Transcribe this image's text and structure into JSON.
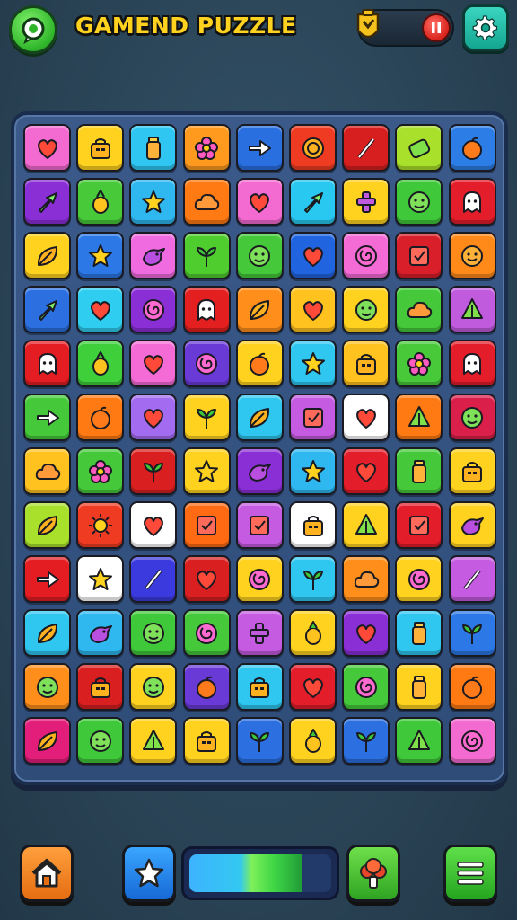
{
  "header": {
    "title": "GAMEND PUZZLE",
    "icons": {
      "logo": "chat-bubble-icon",
      "coin": "trophy-badge-icon",
      "red": "pause-icon",
      "settings": "gear-icon"
    }
  },
  "board": {
    "rows": [
      [
        [
          "#f36bd0",
          "heart"
        ],
        [
          "#ffd21f",
          "bag"
        ],
        [
          "#2fc6f2",
          "bottle"
        ],
        [
          "#ff9a1f",
          "flower"
        ],
        [
          "#2a6fe0",
          "arrow"
        ],
        [
          "#ef3b22",
          "coin"
        ],
        [
          "#d81f1f",
          "leaf-slash"
        ],
        [
          "#a8e02b",
          "can"
        ],
        [
          "#2d7de6",
          "fruit"
        ]
      ],
      [
        [
          "#8a2fd6",
          "arrow-up"
        ],
        [
          "#47c93a",
          "pineapple"
        ],
        [
          "#2fb7f0",
          "star"
        ],
        [
          "#ff7a12",
          "cloud"
        ],
        [
          "#f36bd0",
          "heart"
        ],
        [
          "#28c8f0",
          "arrow-up"
        ],
        [
          "#ffd21f",
          "cross"
        ],
        [
          "#3fc83a",
          "face"
        ],
        [
          "#e31d2a",
          "ghost"
        ]
      ],
      [
        [
          "#ffd21f",
          "leaf"
        ],
        [
          "#2b78e6",
          "star"
        ],
        [
          "#f06be0",
          "bird"
        ],
        [
          "#4fcd2f",
          "plant"
        ],
        [
          "#45c93a",
          "face"
        ],
        [
          "#2064df",
          "heart"
        ],
        [
          "#f46bd6",
          "swirl"
        ],
        [
          "#d91f2a",
          "card"
        ],
        [
          "#ff8a1a",
          "smile"
        ]
      ],
      [
        [
          "#2b6fe0",
          "arrow-up"
        ],
        [
          "#2fcdf0",
          "heart"
        ],
        [
          "#8a2fd6",
          "swirl"
        ],
        [
          "#e41f1f",
          "ghost"
        ],
        [
          "#ff8f1a",
          "leaf"
        ],
        [
          "#ffc21f",
          "heart"
        ],
        [
          "#ffd21f",
          "face"
        ],
        [
          "#45c93a",
          "cloud"
        ],
        [
          "#c15bde",
          "tree"
        ]
      ],
      [
        [
          "#e31d22",
          "ghost"
        ],
        [
          "#3ecf3a",
          "pineapple"
        ],
        [
          "#f46bd6",
          "heart"
        ],
        [
          "#6a3ad6",
          "swirl"
        ],
        [
          "#ffd21f",
          "fruit"
        ],
        [
          "#2fc6f0",
          "star"
        ],
        [
          "#ffc21f",
          "bag"
        ],
        [
          "#47c93a",
          "flower"
        ],
        [
          "#e31d2a",
          "ghost"
        ]
      ],
      [
        [
          "#45c93a",
          "arrow"
        ],
        [
          "#ff7a12",
          "fruit"
        ],
        [
          "#a26bf0",
          "heart"
        ],
        [
          "#ffd21f",
          "plant"
        ],
        [
          "#2fc6f0",
          "leaf"
        ],
        [
          "#c45be0",
          "card"
        ],
        [
          "#ffffff",
          "heart"
        ],
        [
          "#ff7a12",
          "tree"
        ],
        [
          "#d91f4a",
          "face"
        ]
      ],
      [
        [
          "#ffc21f",
          "cloud"
        ],
        [
          "#45c93a",
          "flower"
        ],
        [
          "#d91f1f",
          "plant"
        ],
        [
          "#ffd21f",
          "star"
        ],
        [
          "#8a2fd6",
          "bird"
        ],
        [
          "#2fb7f0",
          "star"
        ],
        [
          "#e31d2a",
          "heart"
        ],
        [
          "#45c93a",
          "bottle"
        ],
        [
          "#ffd21f",
          "bag"
        ]
      ],
      [
        [
          "#a8e02b",
          "leaf"
        ],
        [
          "#ef3b22",
          "sun"
        ],
        [
          "#ffffff",
          "heart"
        ],
        [
          "#ff6a12",
          "card"
        ],
        [
          "#c45be0",
          "card"
        ],
        [
          "#ffffff",
          "bag"
        ],
        [
          "#ffd21f",
          "tree"
        ],
        [
          "#e31d2a",
          "card"
        ],
        [
          "#ffd21f",
          "bird"
        ]
      ],
      [
        [
          "#e31d22",
          "arrow"
        ],
        [
          "#ffffff",
          "star"
        ],
        [
          "#3b3adf",
          "leaf-slash"
        ],
        [
          "#d91f1f",
          "heart"
        ],
        [
          "#ffd21f",
          "swirl"
        ],
        [
          "#2fc6f0",
          "plant"
        ],
        [
          "#ff8f1a",
          "cloud"
        ],
        [
          "#ffd21f",
          "swirl"
        ],
        [
          "#c45be0",
          "leaf-slash"
        ]
      ],
      [
        [
          "#2fc6f0",
          "leaf"
        ],
        [
          "#2fb7f0",
          "bird"
        ],
        [
          "#3fc83a",
          "face"
        ],
        [
          "#45c93a",
          "swirl"
        ],
        [
          "#c45be0",
          "cross"
        ],
        [
          "#ffd21f",
          "pineapple"
        ],
        [
          "#8a2fd6",
          "heart"
        ],
        [
          "#2fc6f0",
          "bottle"
        ],
        [
          "#2b78e6",
          "plant"
        ]
      ],
      [
        [
          "#ff8f1a",
          "face"
        ],
        [
          "#d91f1f",
          "bag"
        ],
        [
          "#ffd21f",
          "face"
        ],
        [
          "#6a3ad6",
          "fruit"
        ],
        [
          "#2fc6f0",
          "bag"
        ],
        [
          "#e31d2a",
          "heart"
        ],
        [
          "#45c93a",
          "swirl"
        ],
        [
          "#ffd21f",
          "bottle"
        ],
        [
          "#ff7a12",
          "fruit"
        ]
      ],
      [
        [
          "#e31d7a",
          "leaf"
        ],
        [
          "#3fc83a",
          "face"
        ],
        [
          "#ffd21f",
          "tree"
        ],
        [
          "#ffd21f",
          "bag"
        ],
        [
          "#2b6fe0",
          "plant"
        ],
        [
          "#ffd21f",
          "pineapple"
        ],
        [
          "#2b6fe0",
          "plant"
        ],
        [
          "#3fc83a",
          "tree"
        ],
        [
          "#f36bd0",
          "swirl"
        ]
      ]
    ]
  },
  "footer": {
    "progress_fraction": 0.8,
    "icons": {
      "home": "home-icon",
      "star": "star-icon",
      "tree": "tree-icon",
      "menu": "menu-icon"
    }
  }
}
